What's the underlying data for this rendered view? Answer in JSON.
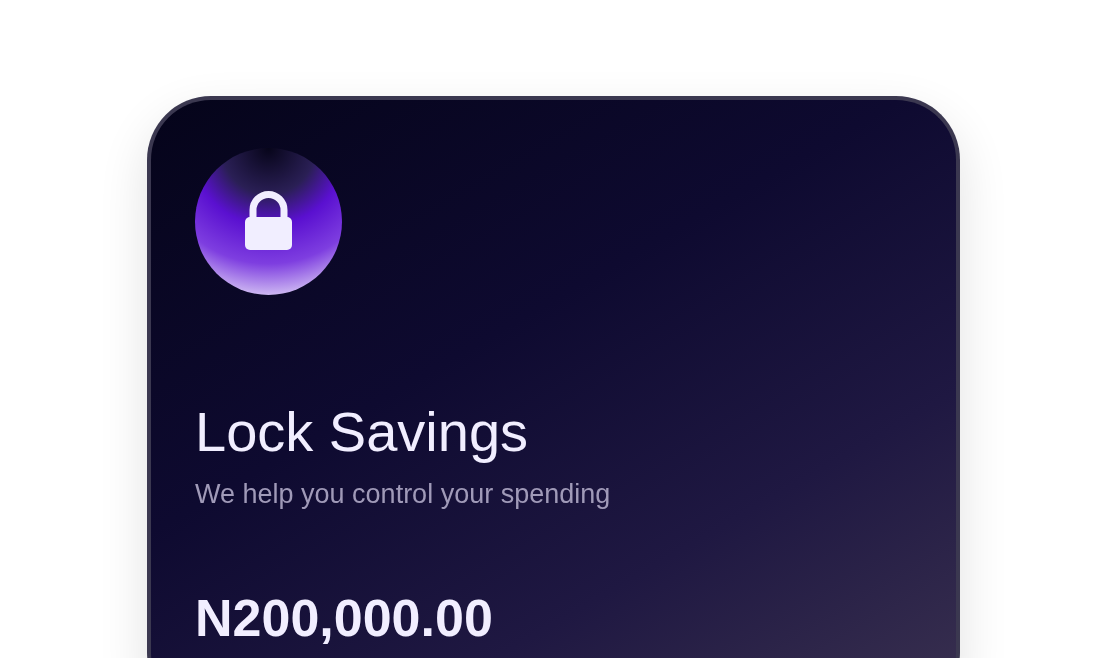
{
  "card": {
    "title": "Lock Savings",
    "subtitle": "We help you control your spending",
    "amount": "N200,000.00"
  }
}
